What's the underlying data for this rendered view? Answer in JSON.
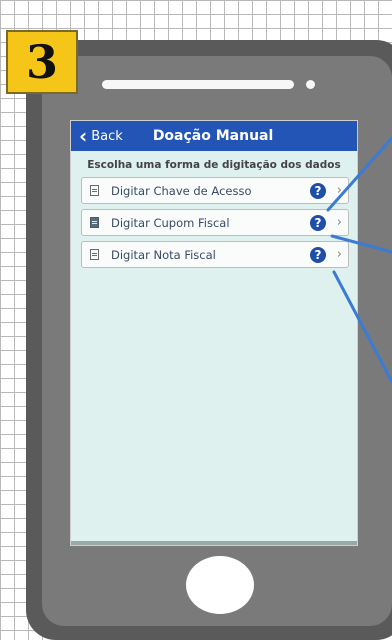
{
  "step": {
    "number": "3",
    "color": "#f5c518"
  },
  "nav": {
    "back_label": "Back",
    "back_icon": "chevron-left",
    "title": "Doação Manual",
    "color": "#2355b7"
  },
  "subtitle": "Escolha uma forma de digitação dos dados",
  "items": [
    {
      "label": "Digitar Chave de Acesso",
      "icon": "barcode-card-icon",
      "help": "?"
    },
    {
      "label": "Digitar Cupom Fiscal",
      "icon": "receipt-icon",
      "help": "?"
    },
    {
      "label": "Digitar Nota Fiscal",
      "icon": "document-icon",
      "help": "?"
    }
  ],
  "colors": {
    "screen_bg": "#def1ef",
    "help_icon": "#1f4ea8",
    "arrow": "#3a7bd5"
  }
}
